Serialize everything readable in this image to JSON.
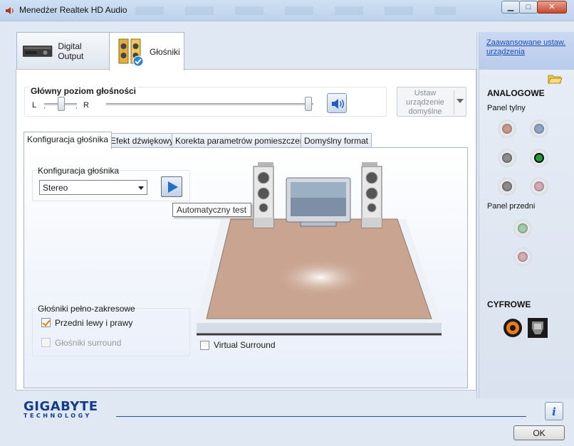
{
  "window": {
    "title": "Menedżer Realtek HD Audio"
  },
  "device_tabs": [
    {
      "label": "Digital Output"
    },
    {
      "label": "Głośniki"
    }
  ],
  "volume": {
    "title": "Główny poziom głośności",
    "left_label": "L",
    "right_label": "R",
    "balance_level": 0.5,
    "volume_level": 0.98
  },
  "default_device": {
    "label": "Ustaw urządzenie domyślne"
  },
  "inner_tabs": [
    {
      "label": "Konfiguracja głośnika"
    },
    {
      "label": "Efekt dźwiękowy"
    },
    {
      "label": "Korekta parametrów pomieszczenia"
    },
    {
      "label": "Domyślny format"
    }
  ],
  "speaker_config": {
    "group_title": "Konfiguracja głośnika",
    "selected": "Stereo",
    "tooltip": "Automatyczny test"
  },
  "fullrange": {
    "group_title": "Głośniki pełno-zakresowe",
    "front_label": "Przedni lewy i prawy",
    "front_checked": true,
    "surround_label": "Głośniki surround",
    "surround_checked": false
  },
  "virtual_surround": {
    "label": "Virtual Surround",
    "checked": false
  },
  "side_panel": {
    "advanced_link": "Zaawansowane ustaw. urządzenia",
    "analog_title": "ANALOGOWE",
    "rear_panel": "Panel tylny",
    "front_panel": "Panel przedni",
    "digital_title": "CYFROWE"
  },
  "colors": {
    "jack_orange": "#c99a86",
    "jack_blue": "#8fa6c9",
    "jack_gray": "#8c8c8c",
    "jack_green_active": "#1e9d3a",
    "jack_pink": "#d8aab4",
    "jack_green_light": "#9fcda9",
    "brand": "#163a8c"
  },
  "footer": {
    "brand_name": "GIGABYTE",
    "brand_sub": "TECHNOLOGY",
    "ok_label": "OK"
  }
}
